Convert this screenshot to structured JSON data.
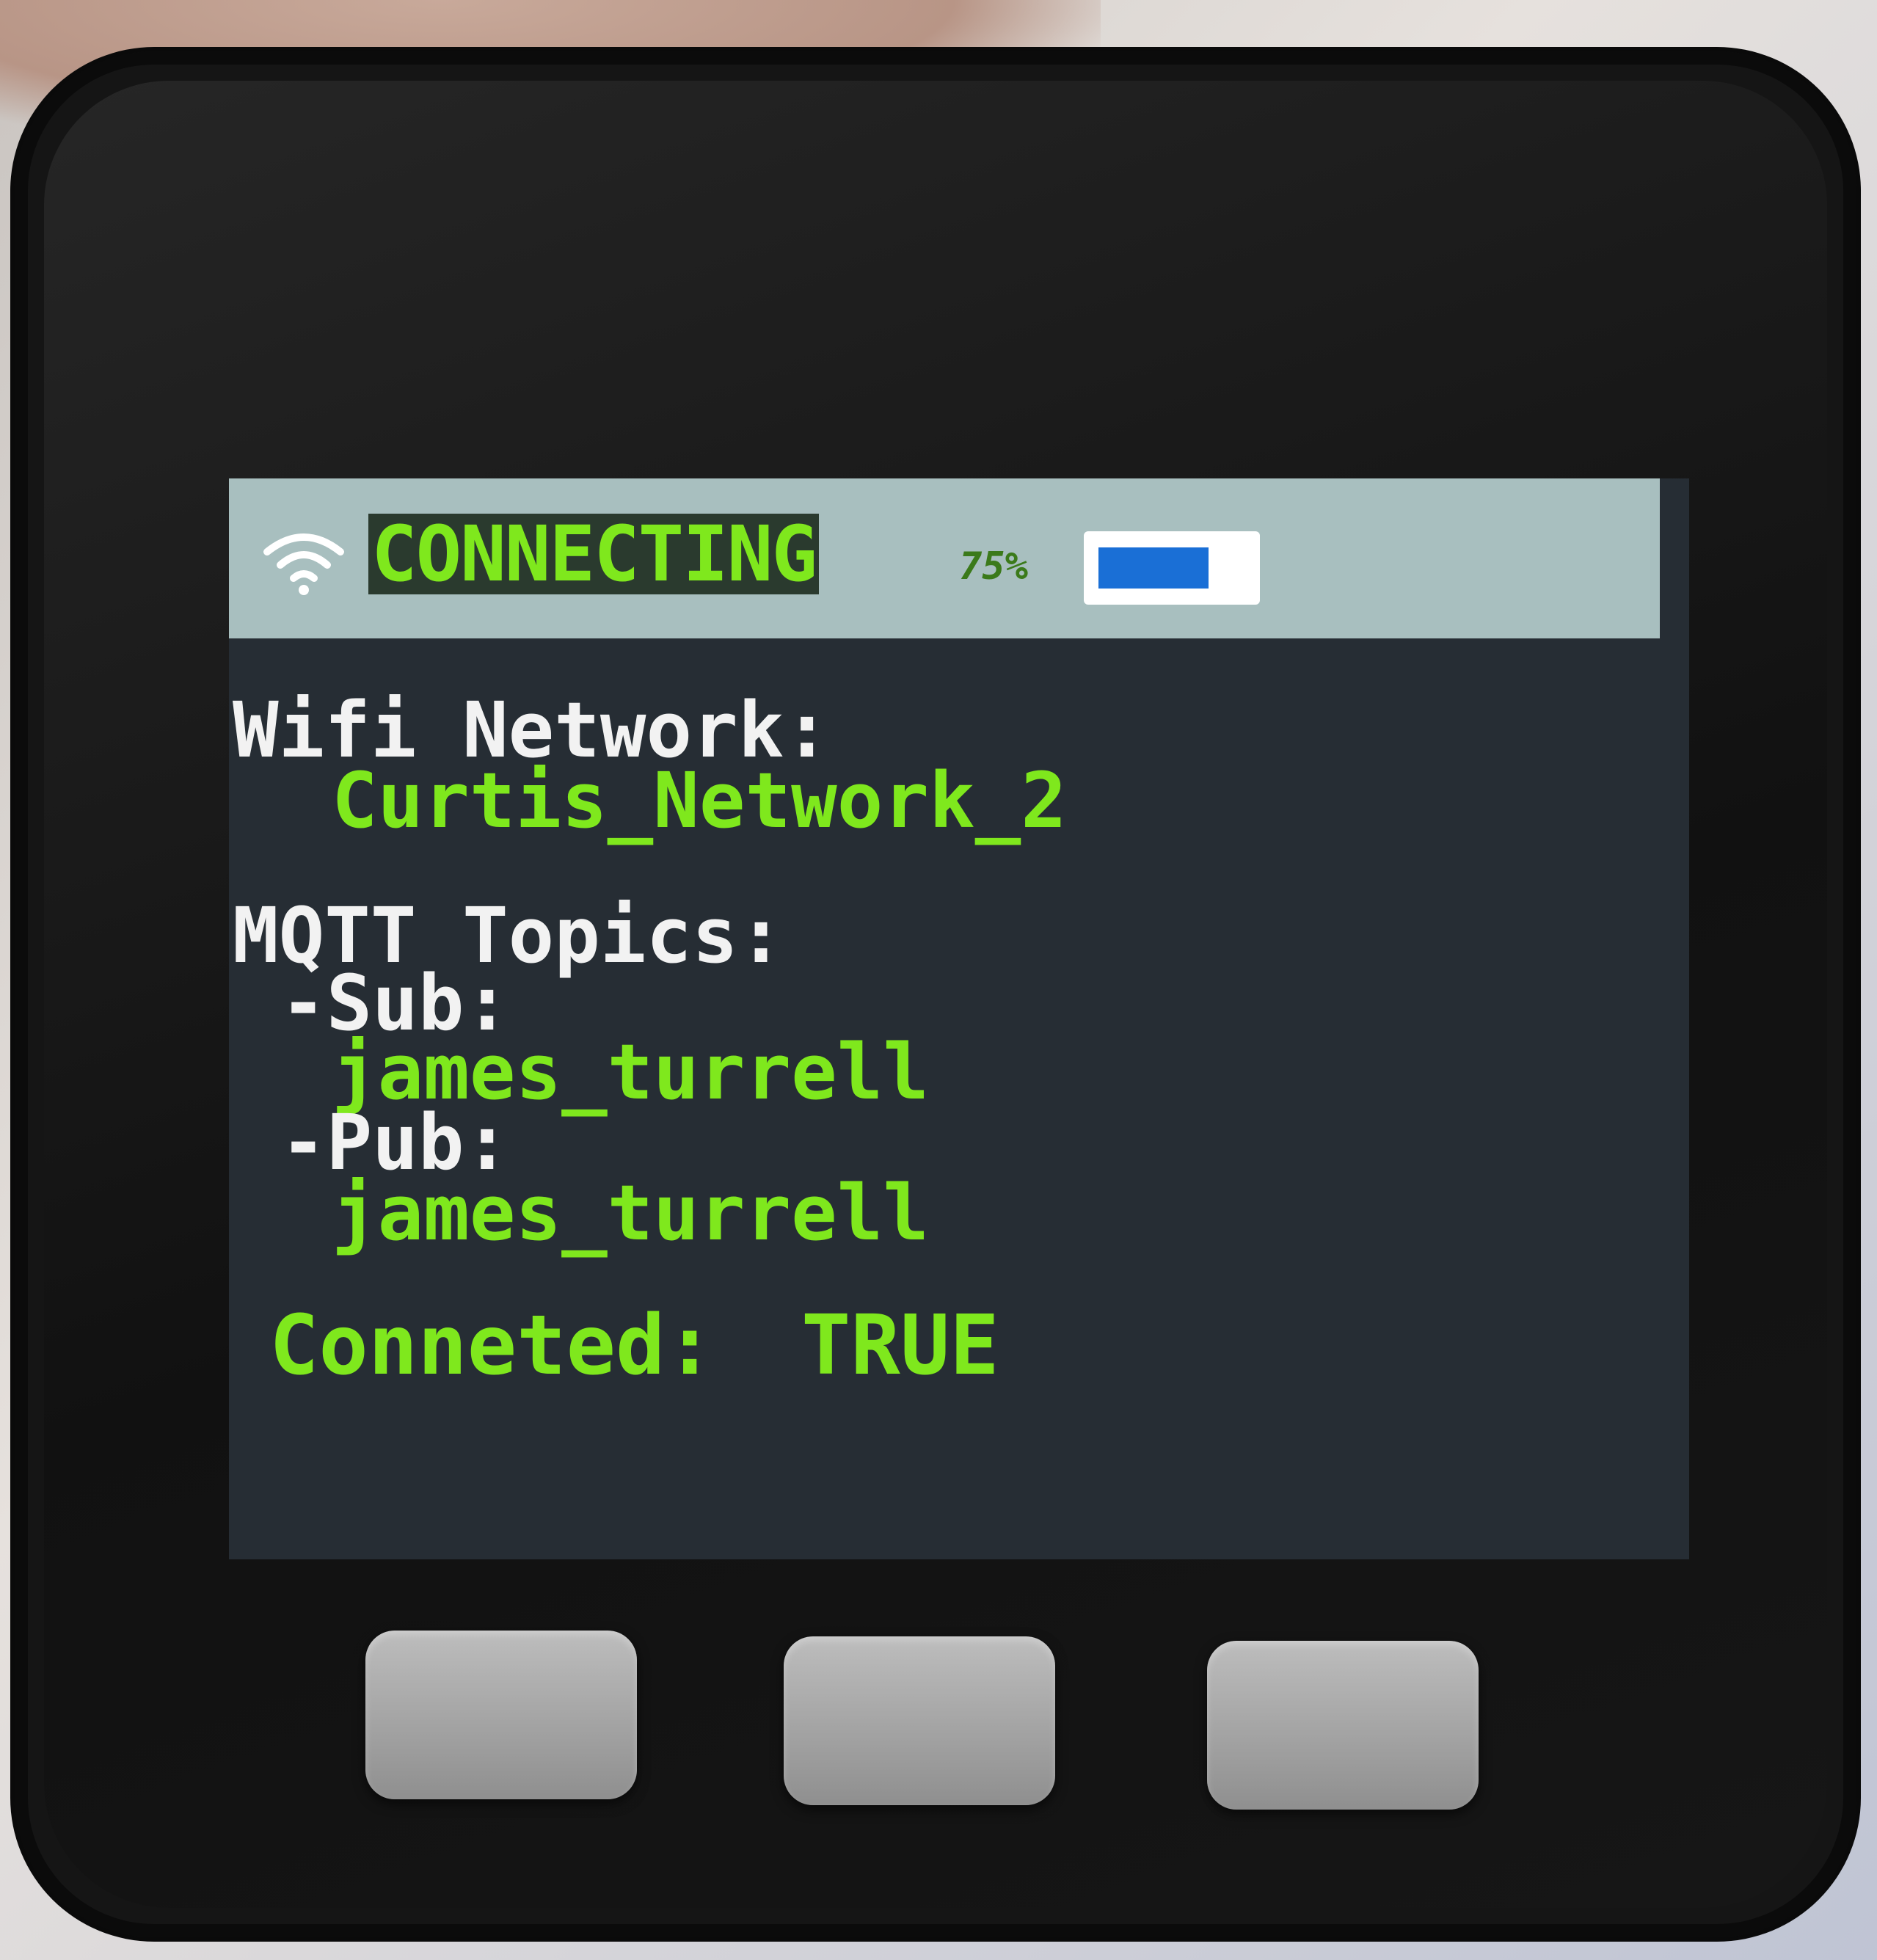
{
  "status_bar": {
    "title": "CONNECTING",
    "battery_percent_label": "75%",
    "battery_level": 0.75,
    "wifi_icon": "wifi-icon"
  },
  "wifi": {
    "label": "Wifi Network:",
    "network_name": "Curtis_Network_2"
  },
  "mqtt": {
    "label": "MQTT Topics:",
    "sub_label": "-Sub:",
    "sub_topic": "james_turrell",
    "pub_label": "-Pub:",
    "pub_topic": "james_turrell"
  },
  "connection": {
    "label": "Conneted:",
    "value": "TRUE"
  },
  "colors": {
    "status_bar_bg": "#a8bfbf",
    "accent_green": "#7fe81d",
    "battery_fill": "#1a6fd6",
    "screen_bg": "#262d34"
  }
}
